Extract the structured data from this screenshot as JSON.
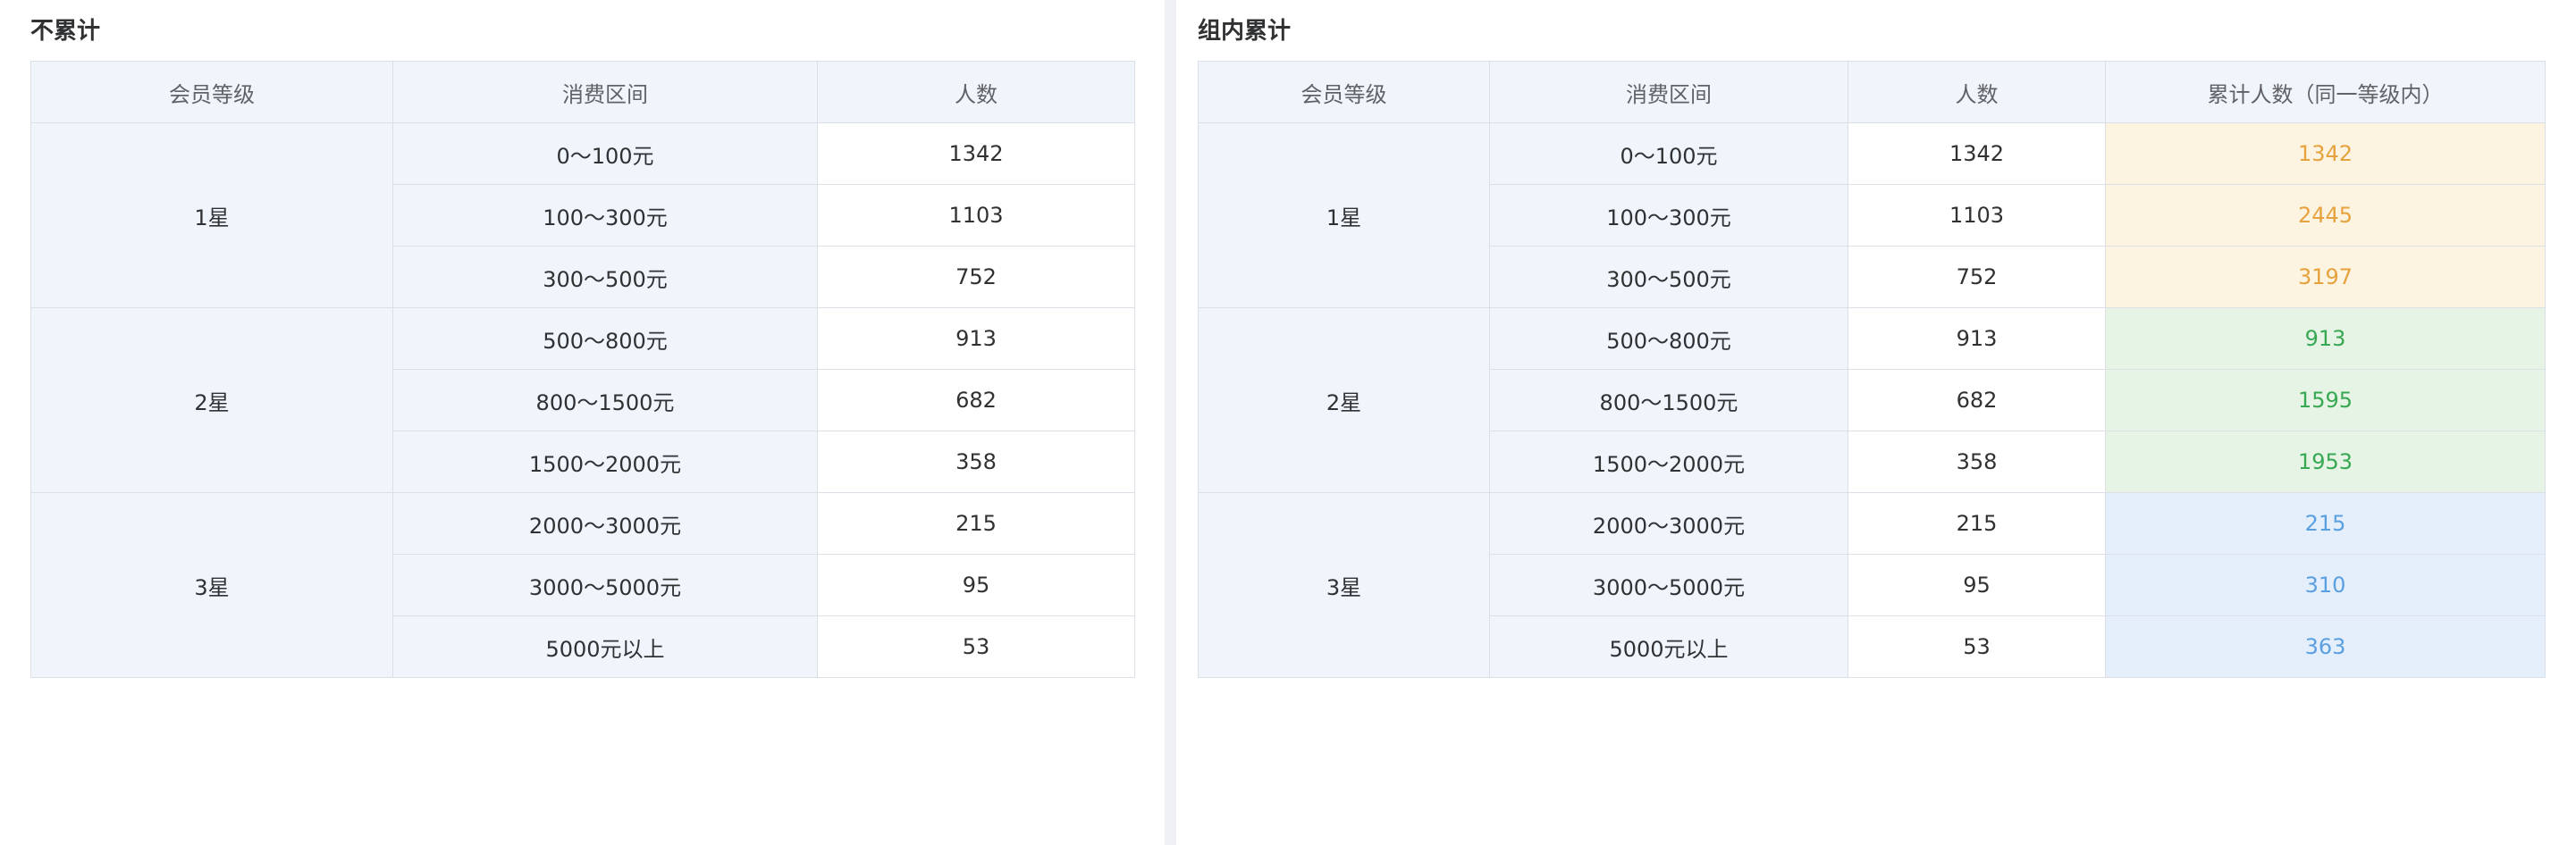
{
  "left": {
    "title": "不累计",
    "headers": [
      "会员等级",
      "消费区间",
      "人数"
    ],
    "groups": [
      {
        "level": "1星",
        "rows": [
          {
            "range": "0～100元",
            "count": "1342"
          },
          {
            "range": "100～300元",
            "count": "1103"
          },
          {
            "range": "300～500元",
            "count": "752"
          }
        ]
      },
      {
        "level": "2星",
        "rows": [
          {
            "range": "500～800元",
            "count": "913"
          },
          {
            "range": "800～1500元",
            "count": "682"
          },
          {
            "range": "1500～2000元",
            "count": "358"
          }
        ]
      },
      {
        "level": "3星",
        "rows": [
          {
            "range": "2000～3000元",
            "count": "215"
          },
          {
            "range": "3000～5000元",
            "count": "95"
          },
          {
            "range": "5000元以上",
            "count": "53"
          }
        ]
      }
    ]
  },
  "right": {
    "title": "组内累计",
    "headers": [
      "会员等级",
      "消费区间",
      "人数",
      "累计人数（同一等级内）"
    ],
    "groups": [
      {
        "level": "1星",
        "rows": [
          {
            "range": "0～100元",
            "count": "1342",
            "cumulative": "1342"
          },
          {
            "range": "100～300元",
            "count": "1103",
            "cumulative": "2445"
          },
          {
            "range": "300～500元",
            "count": "752",
            "cumulative": "3197"
          }
        ]
      },
      {
        "level": "2星",
        "rows": [
          {
            "range": "500～800元",
            "count": "913",
            "cumulative": "913"
          },
          {
            "range": "800～1500元",
            "count": "682",
            "cumulative": "1595"
          },
          {
            "range": "1500～2000元",
            "count": "358",
            "cumulative": "1953"
          }
        ]
      },
      {
        "level": "3星",
        "rows": [
          {
            "range": "2000～3000元",
            "count": "215",
            "cumulative": "215"
          },
          {
            "range": "3000～5000元",
            "count": "95",
            "cumulative": "310"
          },
          {
            "range": "5000元以上",
            "count": "53",
            "cumulative": "363"
          }
        ]
      }
    ]
  },
  "colors": {
    "group1_bg": "#fdf3e1",
    "group1_text": "#e6a23c",
    "group2_bg": "#e6f4e6",
    "group2_text": "#38a852",
    "group3_bg": "#e5effc",
    "group3_text": "#5a9fe0",
    "header_bg": "#f0f5fc",
    "border": "#dcdfe6"
  }
}
